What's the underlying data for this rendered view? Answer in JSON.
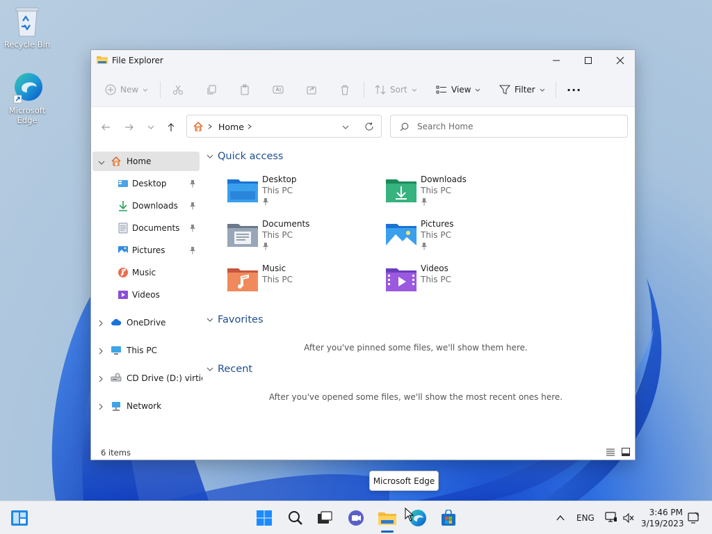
{
  "desktop": {
    "icons": [
      {
        "label": "Recycle Bin",
        "icon": "recycle-bin-icon"
      },
      {
        "label": "Microsoft Edge",
        "icon": "edge-icon"
      }
    ]
  },
  "window": {
    "title": "File Explorer",
    "controls": {
      "minimize": "minimize-icon",
      "maximize": "maximize-icon",
      "close": "close-icon"
    }
  },
  "commandbar": {
    "new_label": "New",
    "sort_label": "Sort",
    "view_label": "View",
    "filter_label": "Filter",
    "more_label": "···"
  },
  "address": {
    "path_label": "Home",
    "search_placeholder": "Search Home"
  },
  "sidebar": {
    "home": "Home",
    "pinned": [
      {
        "label": "Desktop"
      },
      {
        "label": "Downloads"
      },
      {
        "label": "Documents"
      },
      {
        "label": "Pictures"
      },
      {
        "label": "Music"
      },
      {
        "label": "Videos"
      }
    ],
    "roots": [
      {
        "label": "OneDrive"
      },
      {
        "label": "This PC"
      },
      {
        "label": "CD Drive (D:) virtio-win"
      },
      {
        "label": "Network"
      }
    ]
  },
  "content": {
    "quick_access": {
      "heading": "Quick access",
      "items": [
        {
          "name": "Desktop",
          "location": "This PC",
          "pinned": true
        },
        {
          "name": "Downloads",
          "location": "This PC",
          "pinned": true
        },
        {
          "name": "Documents",
          "location": "This PC",
          "pinned": true
        },
        {
          "name": "Pictures",
          "location": "This PC",
          "pinned": true
        },
        {
          "name": "Music",
          "location": "This PC",
          "pinned": false
        },
        {
          "name": "Videos",
          "location": "This PC",
          "pinned": false
        }
      ]
    },
    "favorites": {
      "heading": "Favorites",
      "empty": "After you've pinned some files, we'll show them here."
    },
    "recent": {
      "heading": "Recent",
      "empty": "After you've opened some files, we'll show the most recent ones here."
    }
  },
  "statusbar": {
    "count": "6 items"
  },
  "tooltip": {
    "text": "Microsoft Edge"
  },
  "taskbar": {
    "tray": {
      "language": "ENG",
      "time": "3:46 PM",
      "date": "3/19/2023"
    }
  },
  "colors": {
    "accent": "#0067c0",
    "section_heading": "#1e4e8c"
  }
}
